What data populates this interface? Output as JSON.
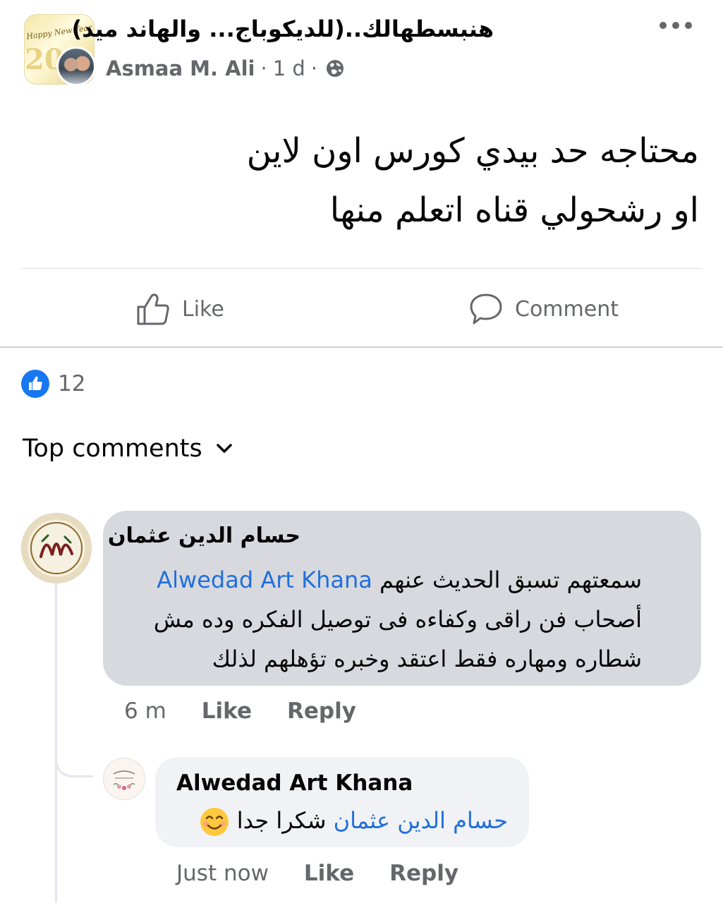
{
  "post": {
    "group_name": "هنبسطهالك..(للديكوباج... والهاند ميد)",
    "author": "Asmaa M. Ali",
    "separator": "·",
    "time": "1 d",
    "privacy_icon": "globe-icon",
    "group_avatar_text": "Happy New Year",
    "group_avatar_year": "202",
    "text_line_1": "محتاجه حد بيدي كورس اون لاين",
    "text_line_2": "او رشحولي قناه اتعلم منها"
  },
  "actions": {
    "like_label": "Like",
    "comment_label": "Comment"
  },
  "reactions": {
    "count": "12",
    "icon": "like-icon"
  },
  "comments_header": {
    "label": "Top comments"
  },
  "comments": [
    {
      "author": "حسام الدين عثمان",
      "mention": "Alwedad Art Khana",
      "line_1_text": "سمعتهم تسبق الحديث عنهم",
      "line_2": "أصحاب فن راقى  وكفاءه فى توصيل الفكره وده مش",
      "line_3": "شطاره ومهاره فقط اعتقد وخبره تؤهلهم لذلك",
      "time": "6 m",
      "like_label": "Like",
      "reply_label": "Reply"
    },
    {
      "author": "Alwedad Art Khana",
      "mention": "حسام الدين عثمان",
      "text": "شكرا جدا",
      "emoji": "smiling-face-icon",
      "time": "Just now",
      "like_label": "Like",
      "reply_label": "Reply"
    }
  ],
  "colors": {
    "accent": "#1877f2",
    "mention": "#216fdb",
    "secondary_text": "#65676b",
    "bubble_primary": "#d7d9de",
    "bubble_secondary": "#f0f2f5"
  }
}
